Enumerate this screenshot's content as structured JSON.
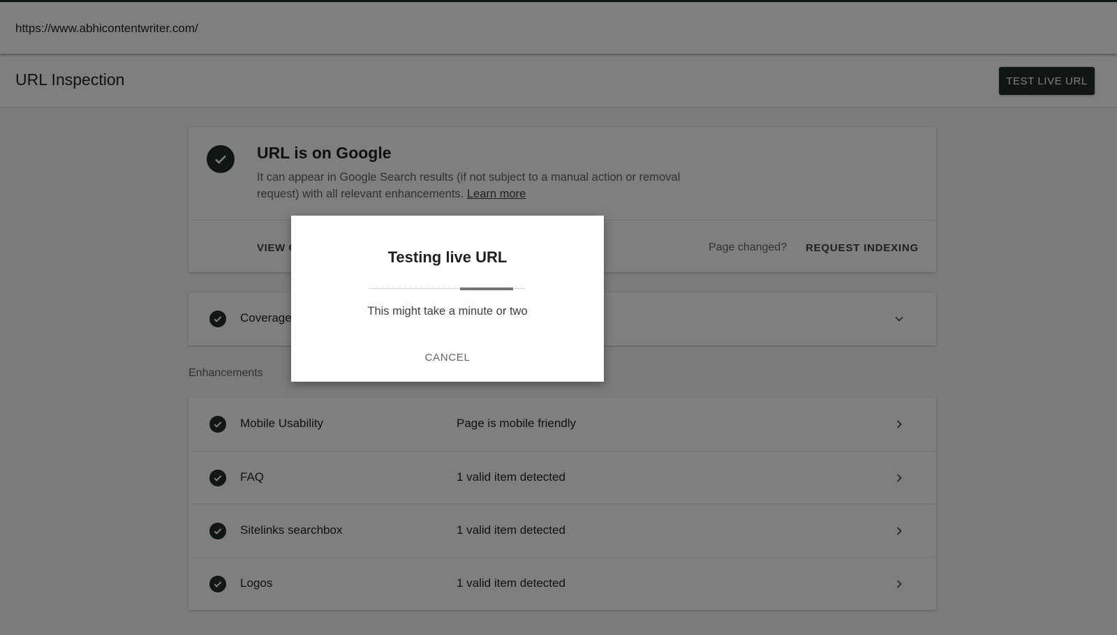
{
  "urlbar": {
    "url": "https://www.abhicontentwriter.com/"
  },
  "header": {
    "title": "URL Inspection",
    "test_live_label": "TEST LIVE URL"
  },
  "status_card": {
    "headline": "URL is on Google",
    "description": "It can appear in Google Search results (if not subject to a manual action or removal request) with all relevant enhancements.",
    "learn_more": "Learn more",
    "view_button": "VIEW C",
    "page_changed": "Page changed?",
    "request_indexing": "REQUEST INDEXING",
    "icon": "check-circle-icon"
  },
  "coverage": {
    "label": "Coverage",
    "icon": "chevron-down-icon"
  },
  "enhancements": {
    "heading": "Enhancements",
    "rows": [
      {
        "label": "Mobile Usability",
        "value": "Page is mobile friendly"
      },
      {
        "label": "FAQ",
        "value": "1 valid item detected"
      },
      {
        "label": "Sitelinks searchbox",
        "value": "1 valid item detected"
      },
      {
        "label": "Logos",
        "value": "1 valid item detected"
      }
    ]
  },
  "dialog": {
    "title": "Testing live URL",
    "subtitle": "This might take a minute or two",
    "cancel": "CANCEL"
  },
  "colors": {
    "accent": "#1f2d2a",
    "overlay": "rgba(0,0,0,0.5)"
  }
}
